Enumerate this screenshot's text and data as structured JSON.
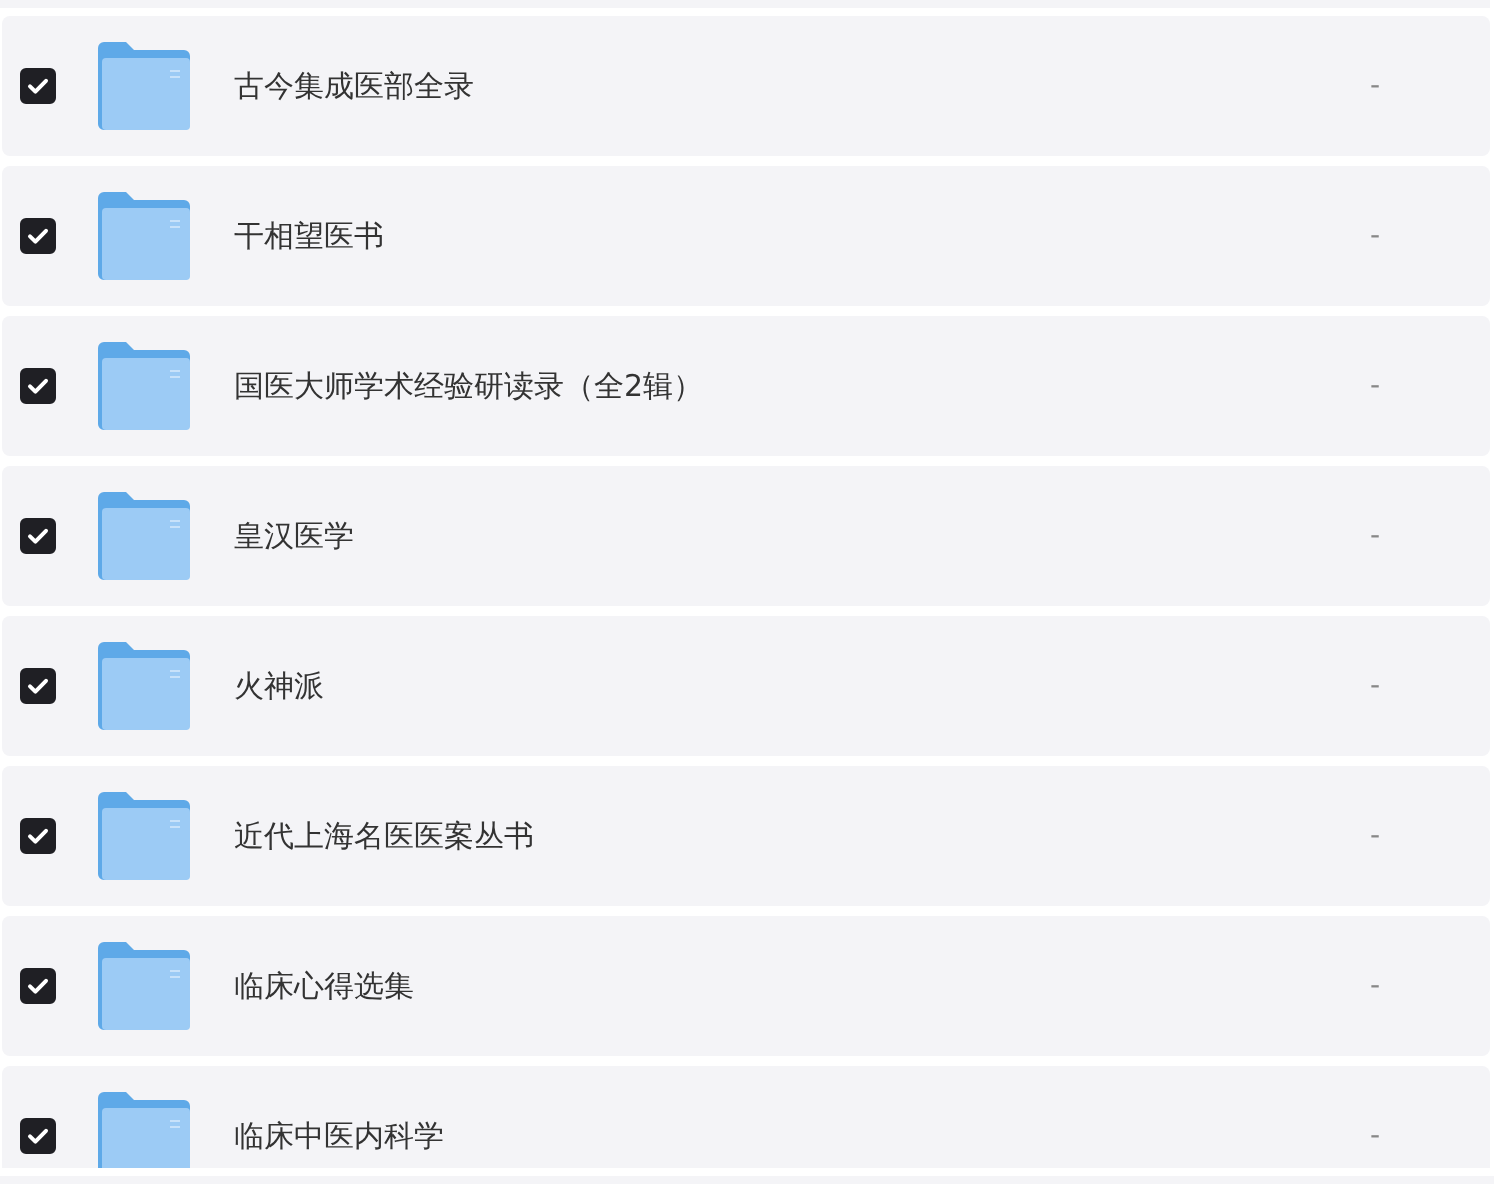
{
  "files": [
    {
      "name": "古今集成医部全录",
      "checked": true,
      "size": "-"
    },
    {
      "name": "干相望医书",
      "checked": true,
      "size": "-"
    },
    {
      "name": "国医大师学术经验研读录（全2辑）",
      "checked": true,
      "size": "-"
    },
    {
      "name": "皇汉医学",
      "checked": true,
      "size": "-"
    },
    {
      "name": "火神派",
      "checked": true,
      "size": "-"
    },
    {
      "name": "近代上海名医医案丛书",
      "checked": true,
      "size": "-"
    },
    {
      "name": "临床心得选集",
      "checked": true,
      "size": "-"
    },
    {
      "name": "临床中医内科学",
      "checked": true,
      "size": "-"
    }
  ]
}
